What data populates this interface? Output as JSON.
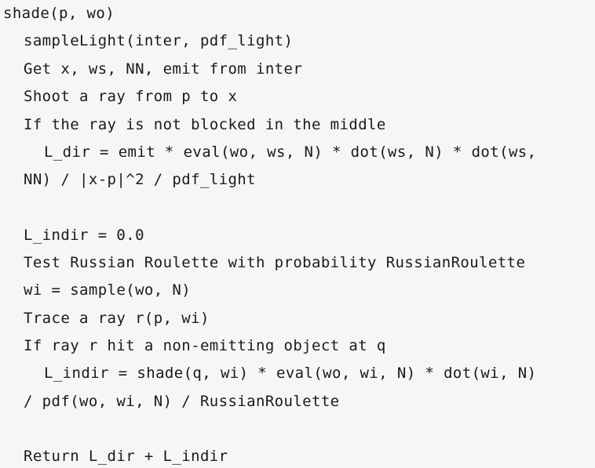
{
  "code": {
    "lines": [
      "shade(p, wo)",
      "sampleLight(inter, pdf_light)",
      "Get x, ws, NN, emit from inter",
      "Shoot a ray from p to x",
      "If the ray is not blocked in the middle",
      "L_dir = emit * eval(wo, ws, N) * dot(ws, N) * dot(ws,",
      "NN) / |x-p|^2 / pdf_light",
      "",
      "L_indir = 0.0",
      "Test Russian Roulette with probability RussianRoulette",
      "wi = sample(wo, N)",
      "Trace a ray r(p, wi)",
      "If ray r hit a non-emitting object at q",
      "L_indir = shade(q, wi) * eval(wo, wi, N) * dot(wi, N)",
      "/ pdf(wo, wi, N) / RussianRoulette",
      "",
      "Return L_dir + L_indir"
    ]
  }
}
